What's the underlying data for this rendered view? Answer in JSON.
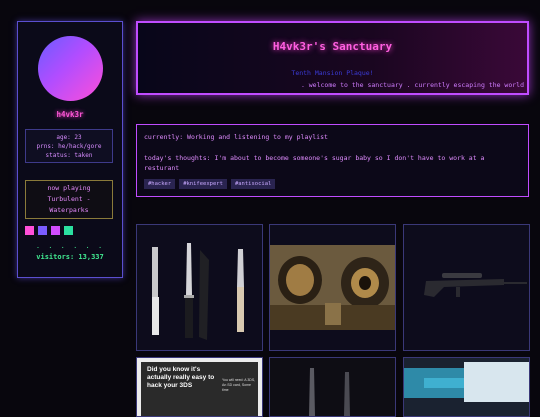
{
  "profile": {
    "username": "h4vk3r",
    "age": "age: 23",
    "pronouns": "prns: he/hack/gore",
    "status": "status: taken",
    "now_playing_label": "now playing",
    "now_playing_track": "Turbulent -",
    "now_playing_artist": "Waterparks",
    "swatches": [
      "#ff4fd8",
      "#7a5cff",
      "#d04cff",
      "#2be0a0"
    ],
    "dots": ". . . . . .",
    "visitors": "visitors: 13,337"
  },
  "header": {
    "title": "H4vk3r's Sanctuary",
    "subtitle": "Tenth Mansion Plaque!",
    "marquee": ". welcome to the sanctuary . currently escaping the world"
  },
  "status": {
    "currently": "currently: Working and listening to my playlist",
    "thoughts": "today's thoughts: I'm about to become someone's sugar baby so I don't have to work at a resturant",
    "tags": [
      "#hacker",
      "#knifeexpert",
      "#antisocial"
    ]
  },
  "gallery": {
    "card4_caption": "Did you know it's actually really easy to hack your 3DS",
    "card4_small": "You will need: A 3DS, An SD card, Some time"
  },
  "colors": {
    "accent": "#c04cff",
    "pink": "#ff5fe0",
    "green": "#40e890"
  }
}
